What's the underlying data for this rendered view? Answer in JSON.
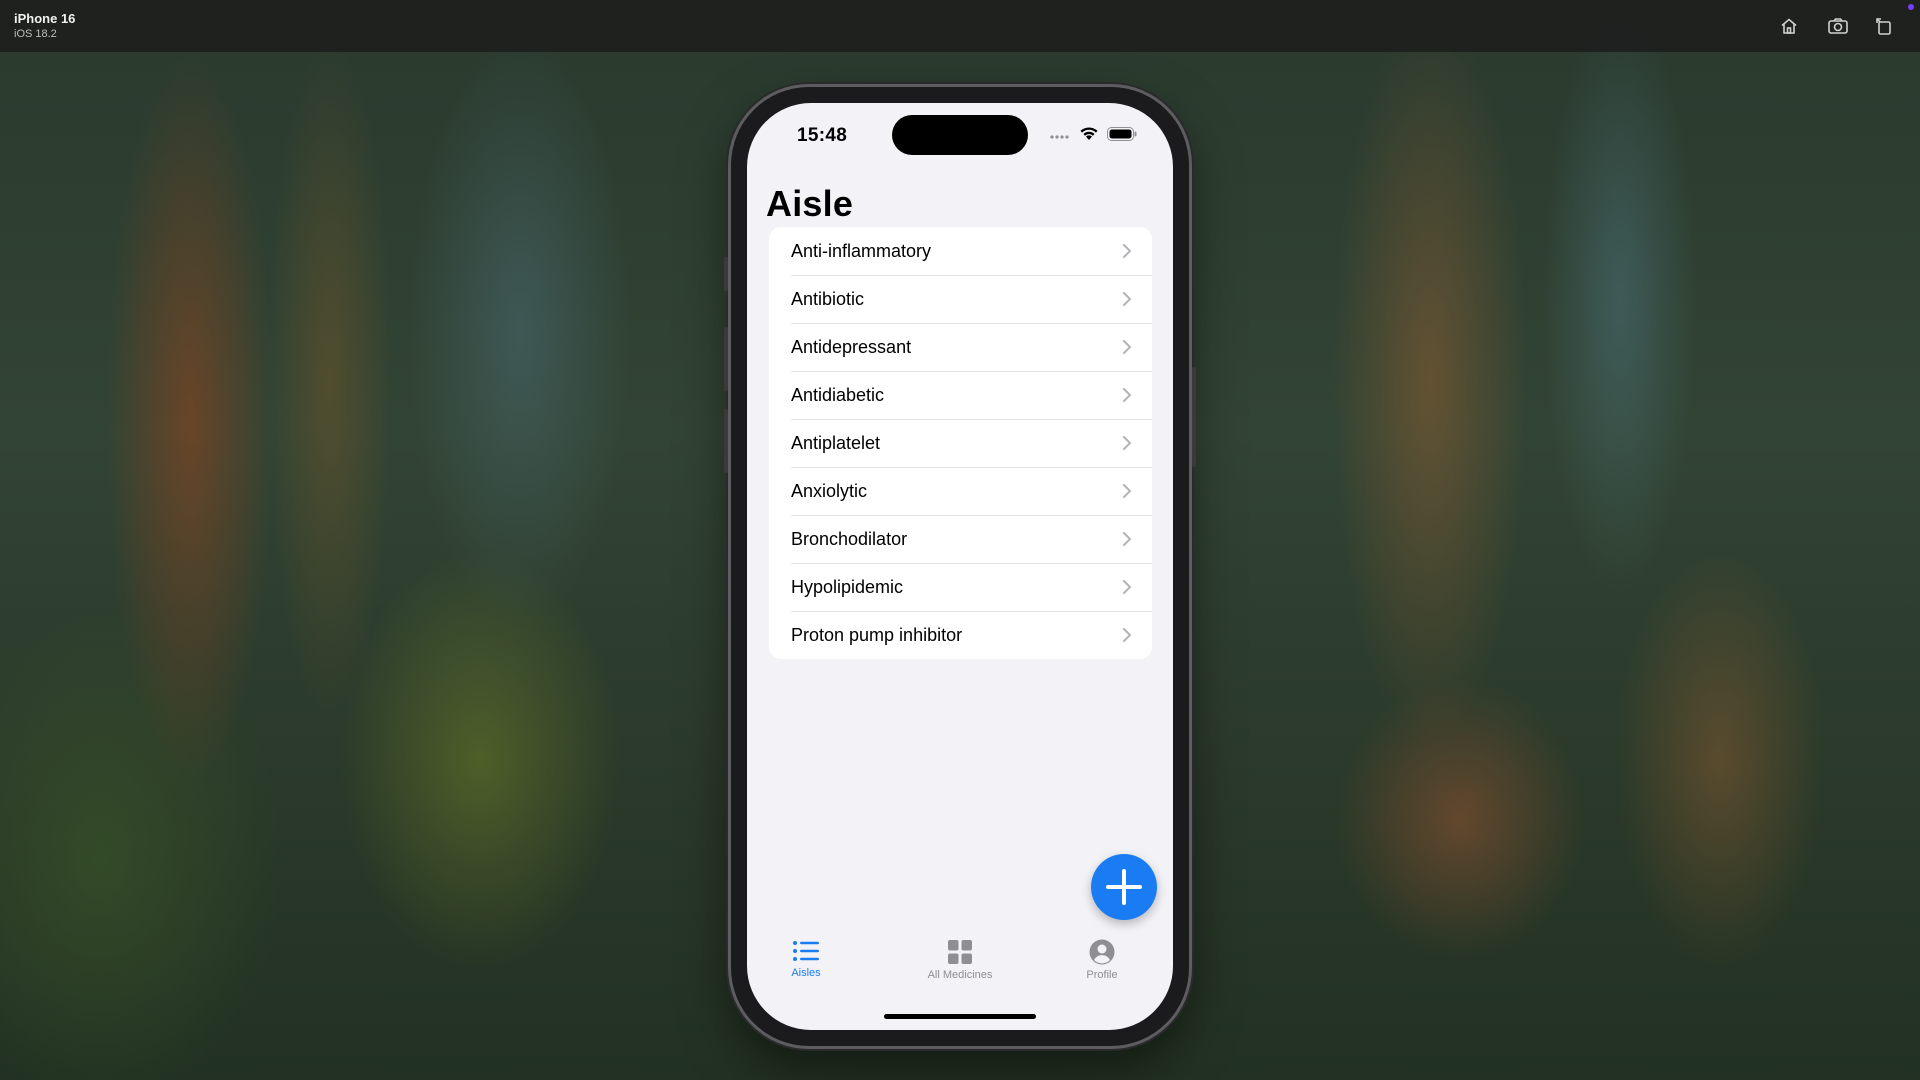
{
  "simulator": {
    "device_name": "iPhone 16",
    "os_version": "iOS 18.2",
    "toolbar_icons": [
      "home-icon",
      "screenshot-icon",
      "rotate-icon"
    ]
  },
  "status_bar": {
    "time": "15:48",
    "icons": [
      "cellular-icon",
      "wifi-icon",
      "battery-icon"
    ]
  },
  "nav": {
    "title": "Aisle"
  },
  "aisles": [
    {
      "label": "Anti-inflammatory"
    },
    {
      "label": "Antibiotic"
    },
    {
      "label": "Antidepressant"
    },
    {
      "label": "Antidiabetic"
    },
    {
      "label": "Antiplatelet"
    },
    {
      "label": "Anxiolytic"
    },
    {
      "label": "Bronchodilator"
    },
    {
      "label": "Hypolipidemic"
    },
    {
      "label": "Proton pump inhibitor"
    }
  ],
  "fab": {
    "icon": "plus-icon"
  },
  "tabs": [
    {
      "label": "Aisles",
      "icon": "list-icon",
      "active": true
    },
    {
      "label": "All Medicines",
      "icon": "grid-icon",
      "active": false
    },
    {
      "label": "Profile",
      "icon": "person-circle-icon",
      "active": false
    }
  ],
  "colors": {
    "accent": "#1a7cf2",
    "inactive": "#8e8e93",
    "background": "#f2f2f7"
  }
}
